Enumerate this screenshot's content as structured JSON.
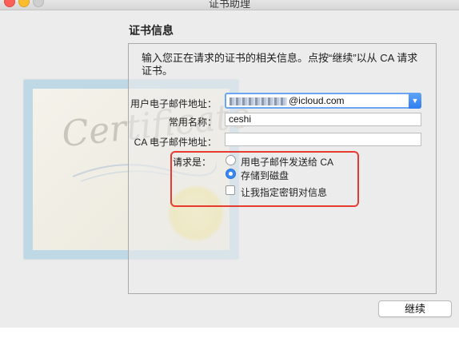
{
  "window": {
    "title": "证书助理"
  },
  "heading": "证书信息",
  "intro": "输入您正在请求的证书的相关信息。点按“继续”以从 CA 请求证书。",
  "form": {
    "email_label": "用户电子邮件地址：",
    "email_value": "@icloud.com",
    "common_name_label": "常用名称：",
    "common_name_value": "ceshi",
    "ca_email_label": "CA 电子邮件地址：",
    "ca_email_value": ""
  },
  "request": {
    "label": "请求是：",
    "options": [
      {
        "label": "用电子邮件发送给 CA",
        "selected": false
      },
      {
        "label": "存储到磁盘",
        "selected": true
      }
    ],
    "checkbox_label": "让我指定密钥对信息",
    "checkbox_checked": false
  },
  "buttons": {
    "continue": "继续"
  },
  "certificate_art": {
    "text": "Certificate"
  },
  "colors": {
    "accent": "#3b87f1",
    "highlight": "#e63b2e"
  }
}
